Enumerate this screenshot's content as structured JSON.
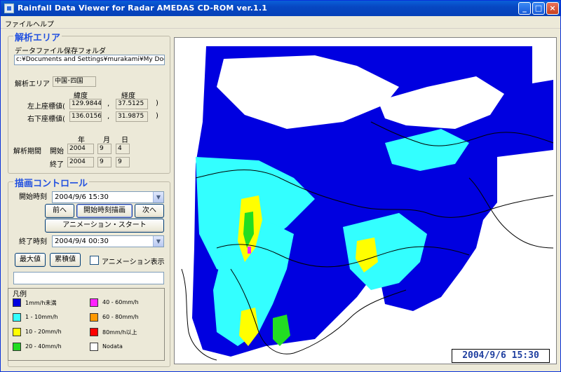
{
  "window": {
    "title": "Rainfall Data Viewer for Radar AMEDAS CD-ROM ver.1.1",
    "controls": [
      "_",
      "□",
      "×"
    ]
  },
  "menu": [
    "ファイル",
    "ヘルプ"
  ],
  "analysis": {
    "group_title": "解析エリア",
    "folder_label": "データファイル保存フォルダ",
    "folder_value": "c:¥Documents and Settings¥murakami¥My Docu",
    "area_label": "解析エリア",
    "area_value": "中国･四国",
    "lat_header": "緯度",
    "lon_header": "経度",
    "upper_left_label": "左上座標値(",
    "upper_left_lat": "129.9844",
    "upper_left_lon": "37.5125",
    "lower_right_label": "右下座標値(",
    "lower_right_lat": "136.0156",
    "lower_right_lon": "31.9875",
    "comma": ",",
    "close_paren": ")",
    "period_label": "解析期間",
    "year_header": "年",
    "month_header": "月",
    "day_header": "日",
    "start_label": "開始",
    "start_year": "2004",
    "start_month": "9",
    "start_day": "4",
    "end_label": "終了",
    "end_year": "2004",
    "end_month": "9",
    "end_day": "9"
  },
  "control": {
    "group_title": "描画コントロール",
    "start_time_label": "開始時刻",
    "start_time_value": "2004/9/6 15:30",
    "prev_button": "前へ",
    "draw_start_button": "開始時刻描画",
    "next_button": "次へ",
    "animation_button": "アニメーション・スタート",
    "end_time_label": "終了時刻",
    "end_time_value": "2004/9/4 00:30",
    "max_button": "最大値",
    "cumulative_button": "累積値",
    "animation_checkbox": "アニメーション表示",
    "animation_checked": false
  },
  "legend": {
    "title": "凡例",
    "items": [
      {
        "label": "1mm/h未満",
        "color": "#0000e0"
      },
      {
        "label": "1 - 10mm/h",
        "color": "#33ffff"
      },
      {
        "label": "10 - 20mm/h",
        "color": "#ffff00"
      },
      {
        "label": "20 - 40mm/h",
        "color": "#22dd22"
      },
      {
        "label": "40 - 60mm/h",
        "color": "#ff22ff"
      },
      {
        "label": "60 - 80mm/h",
        "color": "#ff9900"
      },
      {
        "label": "80mm/h以上",
        "color": "#ff0000"
      },
      {
        "label": "Nodata",
        "color": "#ffffff"
      }
    ]
  },
  "map": {
    "timestamp": "2004/9/6 15:30",
    "colors": {
      "blue": "#0000e0",
      "cyan": "#33ffff",
      "yellow": "#ffff00",
      "green": "#22dd22",
      "magenta": "#ff22ff",
      "coast": "#000000"
    }
  }
}
